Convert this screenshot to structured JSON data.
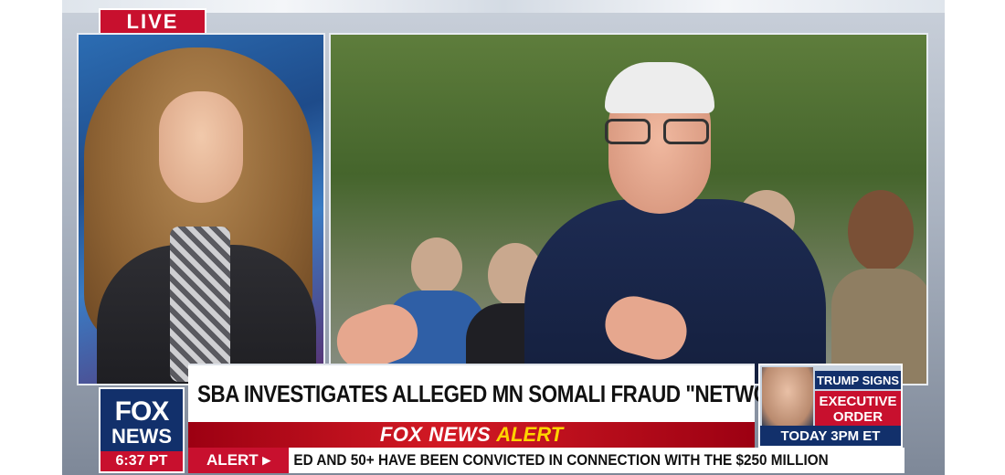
{
  "badge": {
    "live": "LIVE"
  },
  "headline": "SBA INVESTIGATES ALLEGED MN SOMALI FRAUD \"NETWORK\"",
  "alert": {
    "brand": "FOX NEWS",
    "word": "ALERT"
  },
  "logo": {
    "line1": "FOX",
    "line2": "NEWS",
    "time": "6:37 PT"
  },
  "promo": {
    "line1": "TRUMP SIGNS",
    "line2": "EXECUTIVE ORDER",
    "time": "TODAY 3PM ET"
  },
  "ticker": {
    "label": "ALERT ▸",
    "text": "ED AND 50+ HAVE BEEN CONVICTED IN CONNECTION WITH THE $250 MILLION"
  },
  "colors": {
    "fox_red": "#c8102e",
    "fox_navy": "#12306b",
    "alert_yellow": "#ffd400"
  }
}
